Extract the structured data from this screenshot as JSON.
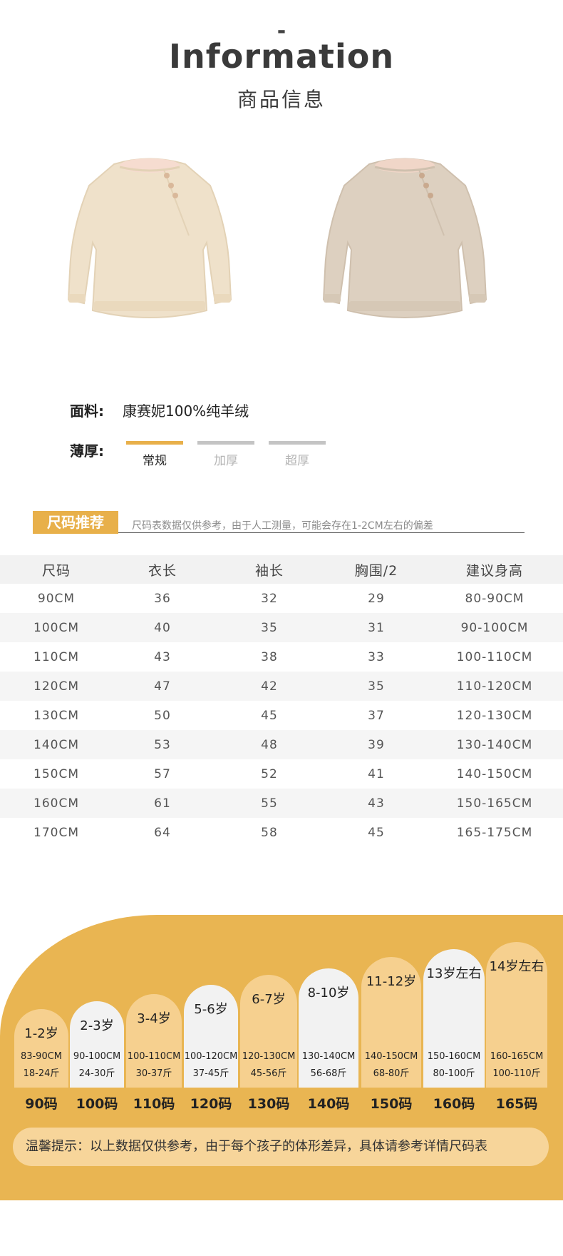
{
  "header": {
    "dash": "-",
    "title_en": "Information",
    "title_cn": "商品信息"
  },
  "product": {
    "fabric_label": "面料:",
    "fabric_value": "康赛妮100%纯羊绒",
    "thickness_label": "薄厚:",
    "thickness_options": [
      {
        "label": "常规",
        "selected": true
      },
      {
        "label": "加厚",
        "selected": false
      },
      {
        "label": "超厚",
        "selected": false
      }
    ],
    "colors": {
      "accent": "#e8b04a",
      "sweater_cream": "#efe1ca",
      "sweater_oat": "#ddd0c0"
    }
  },
  "size_rec": {
    "title": "尺码推荐",
    "note": "尺码表数据仅供参考，由于人工测量，可能会存在1-2CM左右的偏差"
  },
  "size_table": {
    "headers": [
      "尺码",
      "衣长",
      "袖长",
      "胸围/2",
      "建议身高"
    ],
    "rows": [
      [
        "90CM",
        "36",
        "32",
        "29",
        "80-90CM"
      ],
      [
        "100CM",
        "40",
        "35",
        "31",
        "90-100CM"
      ],
      [
        "110CM",
        "43",
        "38",
        "33",
        "100-110CM"
      ],
      [
        "120CM",
        "47",
        "42",
        "35",
        "110-120CM"
      ],
      [
        "130CM",
        "50",
        "45",
        "37",
        "120-130CM"
      ],
      [
        "140CM",
        "53",
        "48",
        "39",
        "130-140CM"
      ],
      [
        "150CM",
        "57",
        "52",
        "41",
        "140-150CM"
      ],
      [
        "160CM",
        "61",
        "55",
        "43",
        "150-165CM"
      ],
      [
        "170CM",
        "64",
        "58",
        "45",
        "165-175CM"
      ]
    ]
  },
  "size_chart": {
    "columns": [
      {
        "age": "1-2岁",
        "height": "83-90CM",
        "weight": "18-24斤",
        "size": "90码",
        "style": "orange"
      },
      {
        "age": "2-3岁",
        "height": "90-100CM",
        "weight": "24-30斤",
        "size": "100码",
        "style": "white"
      },
      {
        "age": "3-4岁",
        "height": "100-110CM",
        "weight": "30-37斤",
        "size": "110码",
        "style": "orange"
      },
      {
        "age": "5-6岁",
        "height": "100-120CM",
        "weight": "37-45斤",
        "size": "120码",
        "style": "white"
      },
      {
        "age": "6-7岁",
        "height": "120-130CM",
        "weight": "45-56斤",
        "size": "130码",
        "style": "orange"
      },
      {
        "age": "8-10岁",
        "height": "130-140CM",
        "weight": "56-68斤",
        "size": "140码",
        "style": "white"
      },
      {
        "age": "11-12岁",
        "height": "140-150CM",
        "weight": "68-80斤",
        "size": "150码",
        "style": "orange"
      },
      {
        "age": "13岁左右",
        "height": "150-160CM",
        "weight": "80-100斤",
        "size": "160码",
        "style": "white"
      },
      {
        "age": "14岁左右",
        "height": "160-165CM",
        "weight": "100-110斤",
        "size": "165码",
        "style": "orange"
      }
    ],
    "colors": {
      "orange": "#f6d08f",
      "white": "#f2f2f2"
    },
    "tip": "温馨提示：以上数据仅供参考，由于每个孩子的体形差异，具体请参考详情尺码表"
  }
}
